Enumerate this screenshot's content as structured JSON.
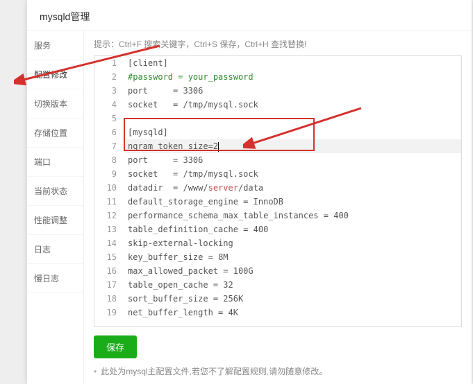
{
  "header": {
    "title": "mysqld管理"
  },
  "sidebar": {
    "items": [
      {
        "label": "服务"
      },
      {
        "label": "配置修改",
        "active": true
      },
      {
        "label": "切换版本"
      },
      {
        "label": "存储位置"
      },
      {
        "label": "端口"
      },
      {
        "label": "当前状态"
      },
      {
        "label": "性能调整"
      },
      {
        "label": "日志"
      },
      {
        "label": "慢日志"
      }
    ]
  },
  "editor": {
    "hint": "提示：Ctrl+F 搜索关键字，Ctrl+S 保存，Ctrl+H 查找替换!",
    "lines": [
      {
        "n": 1,
        "type": "section",
        "text": "[client]"
      },
      {
        "n": 2,
        "type": "comment",
        "text": "#password = your_password"
      },
      {
        "n": 3,
        "type": "kv",
        "key": "port",
        "eqpad": "     = ",
        "val": "3306"
      },
      {
        "n": 4,
        "type": "kv",
        "key": "socket",
        "eqpad": "   = ",
        "val": "/tmp/mysql.sock"
      },
      {
        "n": 5,
        "type": "blank",
        "text": ""
      },
      {
        "n": 6,
        "type": "section",
        "text": "[mysqld]"
      },
      {
        "n": 7,
        "type": "kv",
        "key": "ngram_token_size",
        "eqpad": "=",
        "val": "2",
        "active": true
      },
      {
        "n": 8,
        "type": "kv",
        "key": "port",
        "eqpad": "     = ",
        "val": "3306"
      },
      {
        "n": 9,
        "type": "kv",
        "key": "socket",
        "eqpad": "   = ",
        "val": "/tmp/mysql.sock"
      },
      {
        "n": 10,
        "type": "path",
        "key": "datadir",
        "eqpad": "  = ",
        "pre": "/www/",
        "hl": "server",
        "post": "/data"
      },
      {
        "n": 11,
        "type": "kv",
        "key": "default_storage_engine",
        "eqpad": " = ",
        "val": "InnoDB"
      },
      {
        "n": 12,
        "type": "kv",
        "key": "performance_schema_max_table_instances",
        "eqpad": " = ",
        "val": "400"
      },
      {
        "n": 13,
        "type": "kv",
        "key": "table_definition_cache",
        "eqpad": " = ",
        "val": "400"
      },
      {
        "n": 14,
        "type": "plain",
        "text": "skip-external-locking"
      },
      {
        "n": 15,
        "type": "kv",
        "key": "key_buffer_size",
        "eqpad": " = ",
        "val": "8M"
      },
      {
        "n": 16,
        "type": "kv",
        "key": "max_allowed_packet",
        "eqpad": " = ",
        "val": "100G"
      },
      {
        "n": 17,
        "type": "kv",
        "key": "table_open_cache",
        "eqpad": " = ",
        "val": "32"
      },
      {
        "n": 18,
        "type": "kv",
        "key": "sort_buffer_size",
        "eqpad": " = ",
        "val": "256K"
      },
      {
        "n": 19,
        "type": "kv",
        "key": "net_buffer_length",
        "eqpad": " = ",
        "val": "4K"
      }
    ]
  },
  "actions": {
    "save_label": "保存",
    "footnote": "此处为mysql主配置文件,若您不了解配置规则,请勿随意修改。"
  },
  "colors": {
    "accent_green": "#1aad19",
    "annotation_red": "#d4312c"
  }
}
